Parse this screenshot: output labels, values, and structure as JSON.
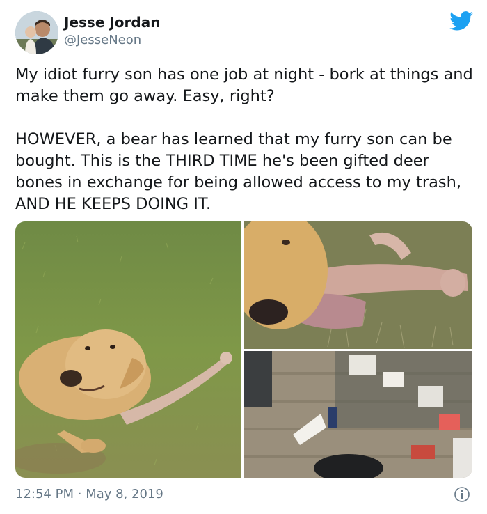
{
  "tweet": {
    "display_name": "Jesse Jordan",
    "handle": "@JesseNeon",
    "text": "My idiot furry son has one job at night - bork at things and make them go away. Easy, right?\n\nHOWEVER, a bear has learned that my furry son can be bought. This is the THIRD TIME he's been gifted deer bones in exchange for being allowed access to my trash, AND HE KEEPS DOING IT.",
    "time": "12:54 PM",
    "separator": "·",
    "date": "May 8, 2019"
  },
  "colors": {
    "brand": "#1da1f2",
    "secondary_text": "#657786",
    "primary_text": "#14171a"
  },
  "icons": {
    "logo": "twitter-bird-icon",
    "info": "info-icon"
  }
}
